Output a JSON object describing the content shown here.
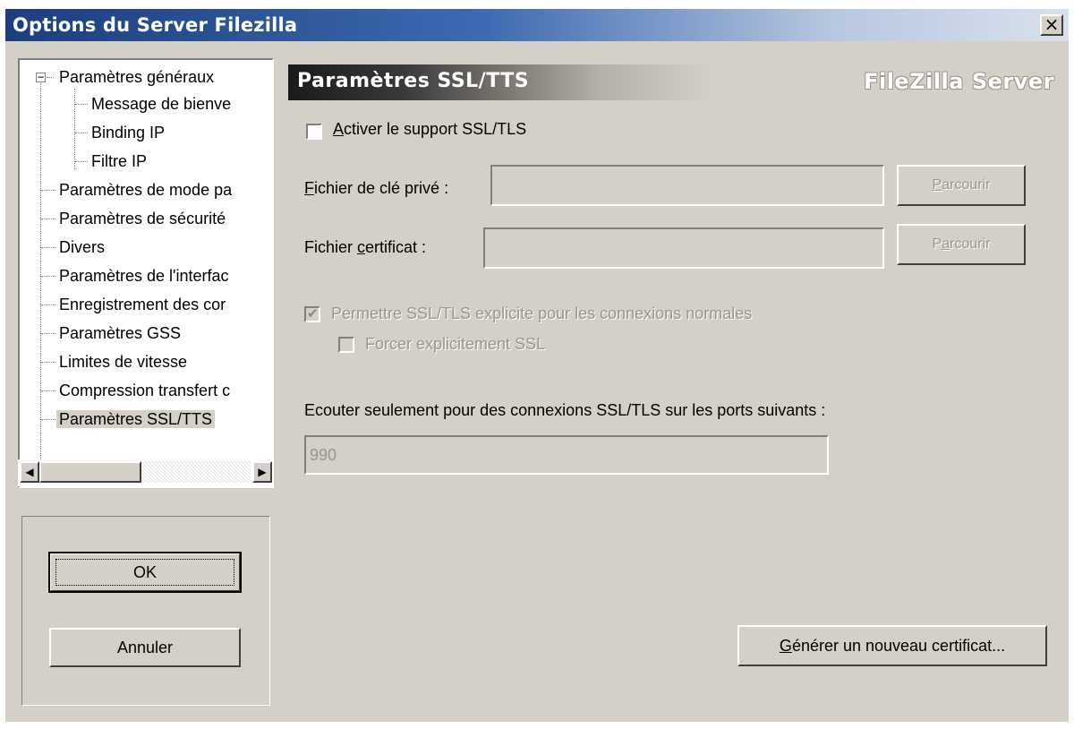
{
  "window": {
    "title": "Options du Server Filezilla",
    "close_glyph": "×"
  },
  "tree": {
    "items": [
      {
        "label": "Paramètres généraux",
        "expander": "−"
      },
      {
        "label": "Message de bienve"
      },
      {
        "label": "Binding IP"
      },
      {
        "label": "Filtre IP"
      },
      {
        "label": "Paramètres de mode pa"
      },
      {
        "label": "Paramètres de sécurité"
      },
      {
        "label": "Divers"
      },
      {
        "label": "Paramètres de l'interfac"
      },
      {
        "label": "Enregistrement des cor"
      },
      {
        "label": "Paramètres GSS"
      },
      {
        "label": "Limites de vitesse"
      },
      {
        "label": "Compression transfert c"
      },
      {
        "label": "Paramètres SSL/TTS",
        "selected": true
      }
    ],
    "scroll_left_glyph": "◀",
    "scroll_right_glyph": "▶"
  },
  "buttons": {
    "ok": "OK",
    "cancel": "Annuler"
  },
  "header": {
    "title": "Paramètres SSL/TTS",
    "brand": "FileZilla Server"
  },
  "ssl": {
    "enable_label_first": "A",
    "enable_label_rest": "ctiver le support SSL/TLS",
    "enable_checked": false,
    "key_label_first": "F",
    "key_label_rest": "ichier de clé privé :",
    "key_value": "",
    "cert_label_pre": "Fichier ",
    "cert_label_u": "c",
    "cert_label_post": "ertificat :",
    "cert_value": "",
    "browse_label_first": "P",
    "browse_label_rest": "arcourir",
    "browse2_label_pre": "P",
    "browse2_label_u": "a",
    "browse2_label_post": "rcourir",
    "explicit_label": "Permettre SSL/TLS explicite pour les connexions normales",
    "explicit_checked": true,
    "force_label": "Forcer explicitement SSL",
    "force_checked": false,
    "ports_label": "Ecouter seulement pour des connexions SSL/TLS sur les ports suivants :",
    "ports_value": "990",
    "generate_label_first": "G",
    "generate_label_rest": "énérer un nouveau certificat..."
  },
  "icons": {
    "check": "check-icon",
    "close": "close-icon",
    "collapse": "collapse-icon"
  }
}
